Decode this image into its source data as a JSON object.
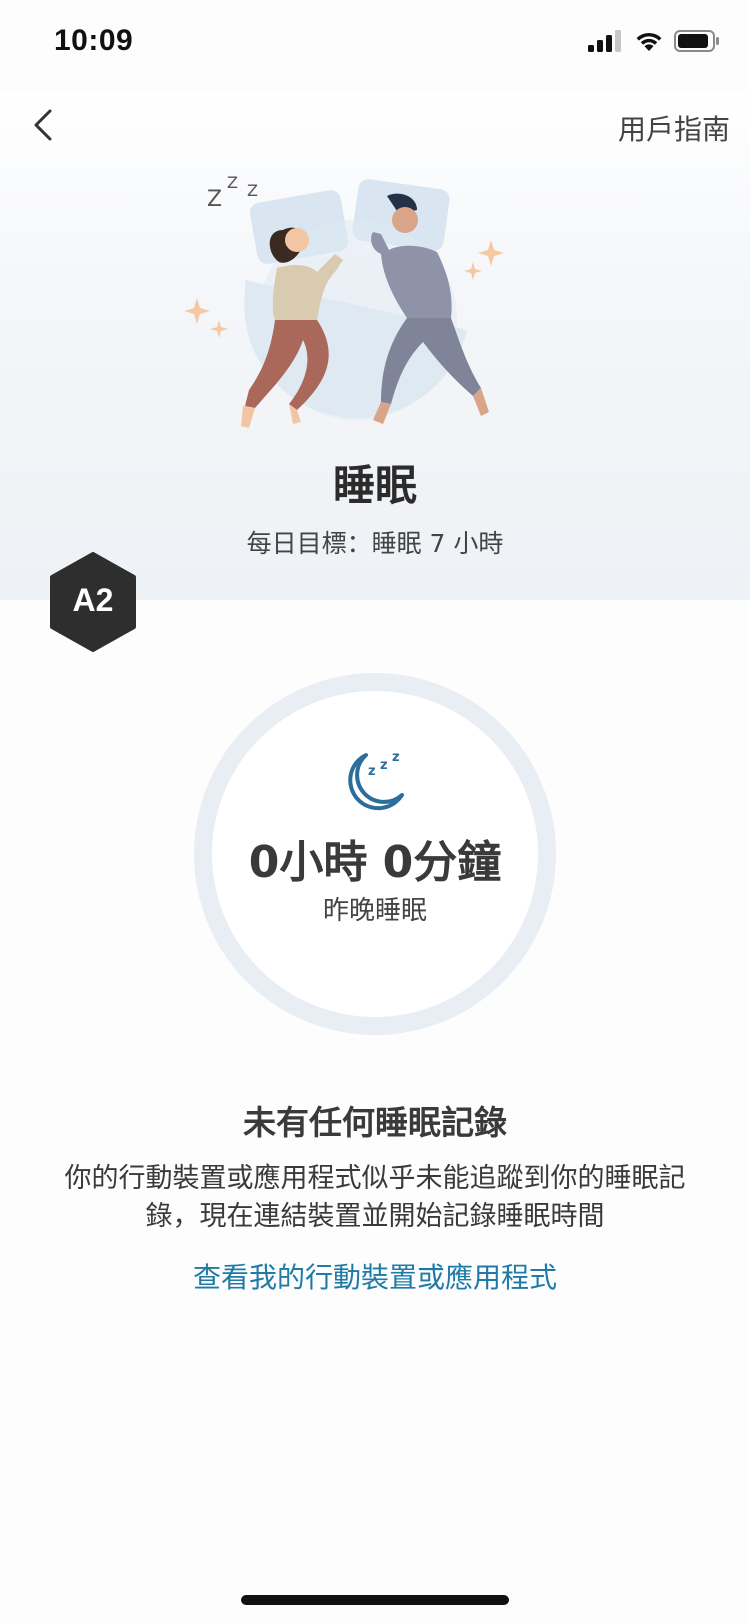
{
  "status_bar": {
    "time": "10:09",
    "icons": [
      "signal-icon",
      "wifi-icon",
      "battery-icon"
    ]
  },
  "nav": {
    "back_icon": "chevron-left-icon",
    "guide_label": "用戶指南"
  },
  "hero": {
    "illustration": "sleeping-couple-illustration",
    "title": "睡眠",
    "daily_goal": "每日目標：睡眠 7 小時"
  },
  "badge": {
    "text": "A2"
  },
  "summary": {
    "icon": "moon-zzz-icon",
    "value": "0小時 0分鐘",
    "label": "昨晚睡眠"
  },
  "empty_state": {
    "title": "未有任何睡眠記錄",
    "description": "你的行動裝置或應用程式似乎未能追蹤到你的睡眠記錄，現在連結裝置並開始記錄睡眠時間",
    "link_label": "查看我的行動裝置或應用程式"
  },
  "colors": {
    "accent_link": "#1f7ba6",
    "moon_icon": "#2c6e9b",
    "ring": "#e9eef4",
    "badge": "#2e2e2e"
  }
}
